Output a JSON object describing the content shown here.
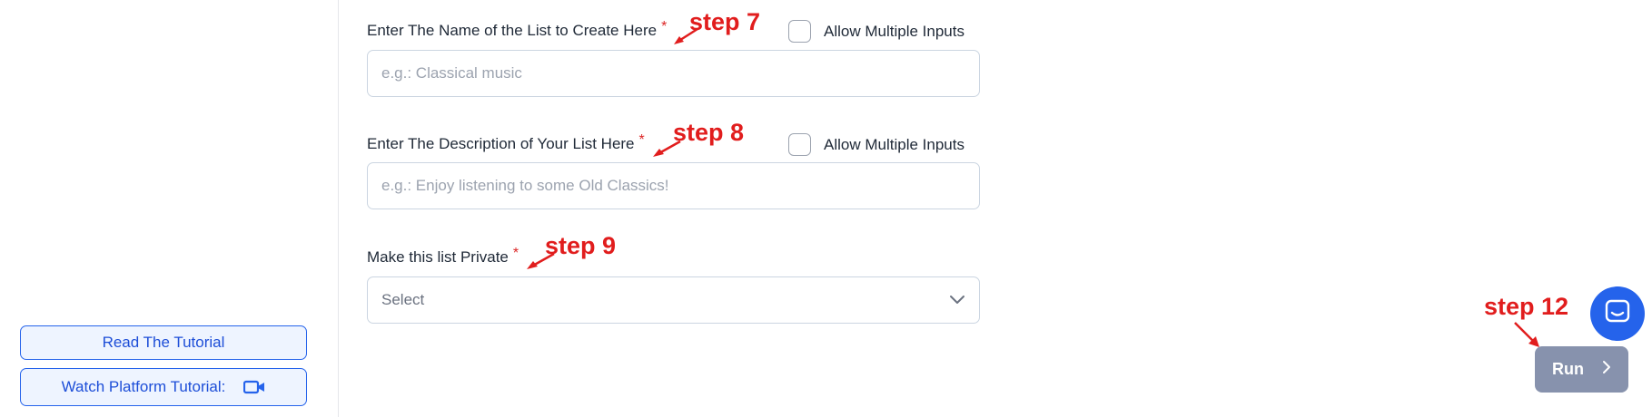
{
  "sidebar": {
    "tutorial_label": "Read The Tutorial",
    "platform_label": "Watch Platform Tutorial:"
  },
  "form": {
    "list_name": {
      "label": "Enter The Name of the List to Create Here",
      "required_mark": "*",
      "placeholder": "e.g.: Classical music",
      "value": "",
      "multi_label": "Allow Multiple Inputs",
      "multi_checked": false
    },
    "list_description": {
      "label": "Enter The Description of Your List Here",
      "required_mark": "*",
      "placeholder": "e.g.: Enjoy listening to some Old Classics!",
      "value": "",
      "multi_label": "Allow Multiple Inputs",
      "multi_checked": false
    },
    "privacy": {
      "label": "Make this list Private",
      "required_mark": "*",
      "selected": "Select"
    }
  },
  "annotations": {
    "step7": "step 7",
    "step8": "step 8",
    "step9": "step 9",
    "step12": "step 12"
  },
  "run_button": {
    "label": "Run"
  },
  "colors": {
    "primary": "#2563eb",
    "annotation": "#e11d1d",
    "run_button": "#8792ad",
    "required": "#dc2626"
  }
}
